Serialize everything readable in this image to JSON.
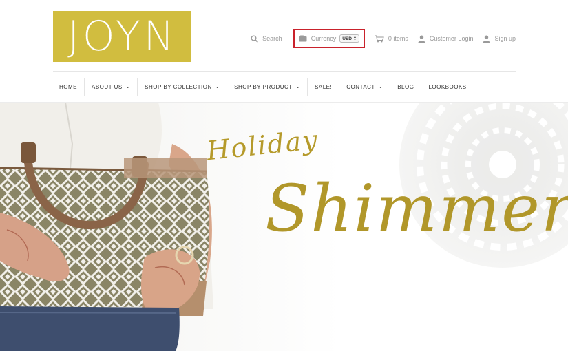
{
  "brand": {
    "logo_text": "JOYN",
    "color": "#d1bd3f"
  },
  "topbar": {
    "search_label": "Search",
    "currency_label": "Currency",
    "currency_value": "USD",
    "cart_label": "0 items",
    "login_label": "Customer Login",
    "signup_label": "Sign up",
    "highlight_color": "#c9222c"
  },
  "nav": {
    "items": [
      {
        "label": "HOME"
      },
      {
        "label": "ABOUT US",
        "dropdown": true
      },
      {
        "label": "SHOP BY COLLECTION",
        "dropdown": true
      },
      {
        "label": "SHOP BY PRODUCT",
        "dropdown": true
      },
      {
        "label": "SALE!"
      },
      {
        "label": "CONTACT",
        "dropdown": true
      },
      {
        "label": "BLOG"
      },
      {
        "label": "LOOKBOOKS"
      }
    ]
  },
  "hero": {
    "line1": "Holiday",
    "line2": "Shimmer",
    "text_color": "#b1972a"
  }
}
